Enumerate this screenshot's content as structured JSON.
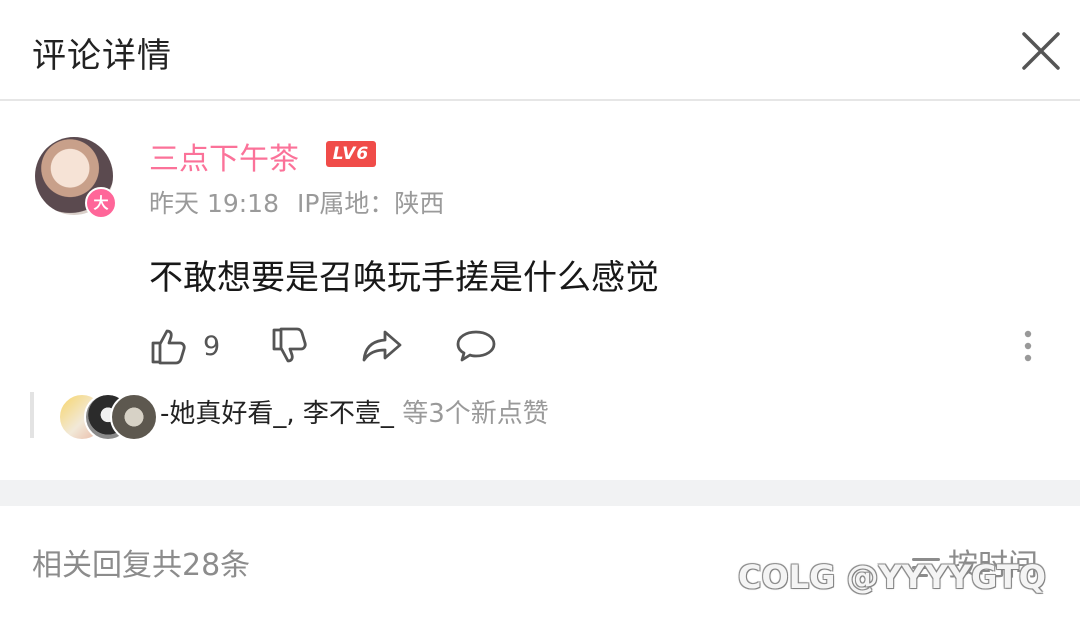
{
  "header": {
    "title": "评论详情",
    "close_icon": "close-icon"
  },
  "comment": {
    "username": "三点下午茶",
    "level": "LV6",
    "badge": "大",
    "date": "昨天 19:18",
    "ip_location": "IP属地：陕西",
    "text": "不敢想要是召唤玩手搓是什么感觉",
    "like_count": "9",
    "username_color": "#fb7299"
  },
  "likers": {
    "names": "-她真好看_, 李不壹_",
    "summary": "等3个新点赞"
  },
  "replies": {
    "count_label": "相关回复共28条",
    "sort_label": "按时间"
  },
  "watermark": "COLG @YYYYGTQ"
}
